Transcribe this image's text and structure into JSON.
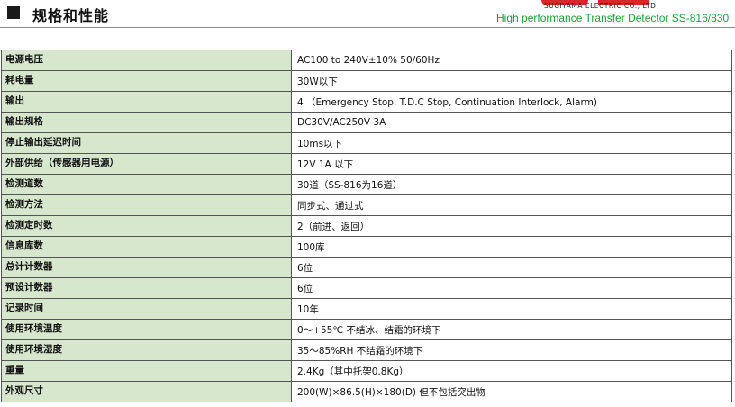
{
  "header": {
    "title": "规格和性能",
    "company": "SUGIYAMA ELECTRIC CO., LTD",
    "subtitle": "High performance Transfer Detector SS-816/830",
    "accent_color": "#1a9e3a",
    "logo_color": "#d9262b"
  },
  "specs": [
    {
      "label": "电源电压",
      "value": "AC100 to 240V±10% 50/60Hz"
    },
    {
      "label": "耗电量",
      "value": "30W以下"
    },
    {
      "label": "输出",
      "value": "4 （Emergency Stop, T.D.C Stop, Continuation Interlock, Alarm)"
    },
    {
      "label": "输出规格",
      "value": "DC30V/AC250V 3A"
    },
    {
      "label": "停止输出延迟时间",
      "value": "10ms以下"
    },
    {
      "label": "外部供给（传感器用电源）",
      "value": "12V 1A 以下"
    },
    {
      "label": "检测道数",
      "value": "30道（SS-816为16道）"
    },
    {
      "label": "检测方法",
      "value": "同步式、通过式"
    },
    {
      "label": "检测定时数",
      "value": "2（前进、返回）"
    },
    {
      "label": "信息库数",
      "value": "100库"
    },
    {
      "label": "总计计数器",
      "value": "6位"
    },
    {
      "label": "预设计数器",
      "value": "6位"
    },
    {
      "label": "记录时间",
      "value": "10年"
    },
    {
      "label": "使用环境温度",
      "value": "0～+55℃ 不结冰、结霜的环境下"
    },
    {
      "label": "使用环境湿度",
      "value": "35～85%RH 不结霜的环境下"
    },
    {
      "label": "重量",
      "value": "2.4Kg（其中托架0.8Kg）"
    },
    {
      "label": "外观尺寸",
      "value": "200(W)×86.5(H)×180(D) 但不包括突出物"
    }
  ]
}
